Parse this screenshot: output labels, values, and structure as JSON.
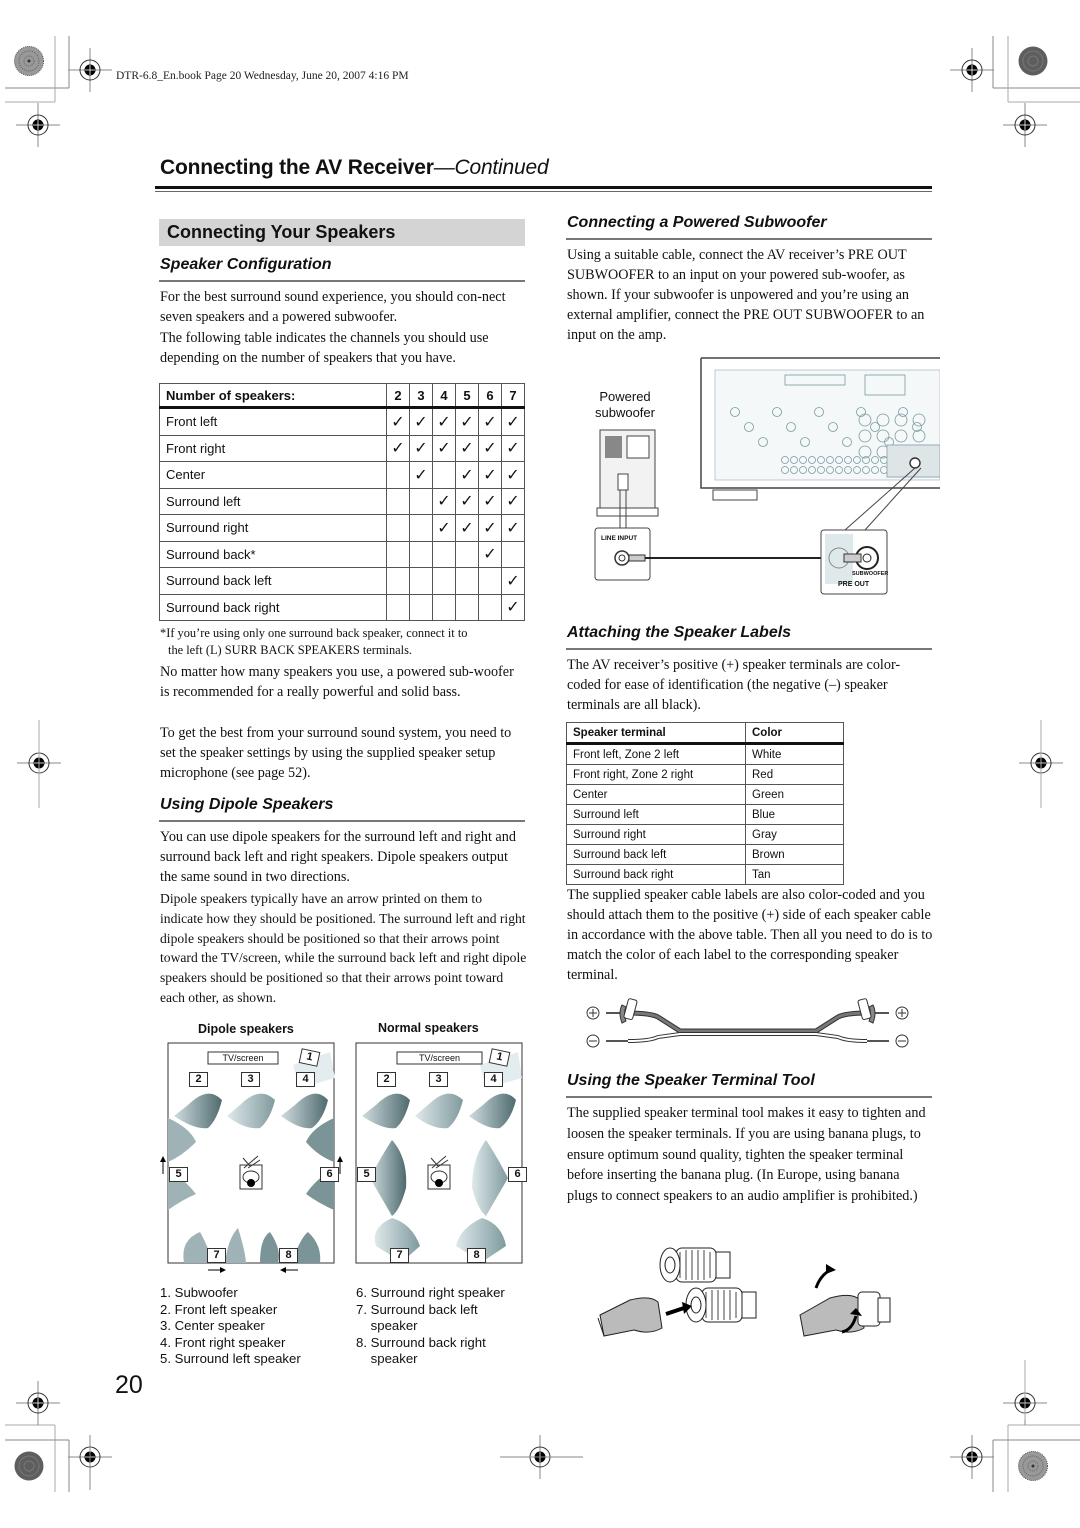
{
  "slug": "DTR-6.8_En.book  Page 20  Wednesday, June 20, 2007  4:16 PM",
  "header": {
    "title": "Connecting the AV Receiver",
    "continued": "—Continued"
  },
  "left": {
    "section_title": "Connecting Your Speakers",
    "speaker_config": {
      "heading": "Speaker Configuration",
      "paragraphs": [
        "For the best surround sound experience, you should con-nect seven speakers and a powered subwoofer.",
        "The following table indicates the channels you should use depending on the number of speakers that you have."
      ],
      "table": {
        "header_label": "Number of speakers:",
        "counts": [
          "2",
          "3",
          "4",
          "5",
          "6",
          "7"
        ],
        "check_glyph": "✓",
        "rows": [
          {
            "label": "Front left",
            "checks": [
              true,
              true,
              true,
              true,
              true,
              true
            ]
          },
          {
            "label": "Front right",
            "checks": [
              true,
              true,
              true,
              true,
              true,
              true
            ]
          },
          {
            "label": "Center",
            "checks": [
              false,
              true,
              false,
              true,
              true,
              true
            ]
          },
          {
            "label": "Surround left",
            "checks": [
              false,
              false,
              true,
              true,
              true,
              true
            ]
          },
          {
            "label": "Surround right",
            "checks": [
              false,
              false,
              true,
              true,
              true,
              true
            ]
          },
          {
            "label": "Surround back*",
            "checks": [
              false,
              false,
              false,
              false,
              true,
              false
            ]
          },
          {
            "label": "Surround back left",
            "checks": [
              false,
              false,
              false,
              false,
              false,
              true
            ]
          },
          {
            "label": "Surround back right",
            "checks": [
              false,
              false,
              false,
              false,
              false,
              true
            ]
          }
        ]
      },
      "footnote_1": "*If you’re using only one surround back speaker, connect it to",
      "footnote_2": "the left (L) SURR BACK SPEAKERS terminals.",
      "para_sub": "No matter how many speakers you use, a powered sub-woofer is recommended for a really powerful and solid bass.",
      "para_setup": "To get the best from your surround sound system, you need to set the speaker settings by using the supplied speaker setup microphone (see page 52)."
    },
    "dipole": {
      "heading": "Using Dipole Speakers",
      "para1": "You can use dipole speakers for the surround left and right and surround back left and right speakers. Dipole speakers output the same sound in two directions.",
      "para2": "Dipole speakers typically have an arrow printed on them to indicate how they should be positioned. The surround left and right dipole speakers should be positioned so that their arrows point toward the TV/screen, while the surround back left and right dipole speakers should be positioned so that their arrows point toward each other, as shown.",
      "diagram_left_title": "Dipole speakers",
      "diagram_right_title": "Normal speakers",
      "tv_label": "TV/screen",
      "box_numbers": [
        "1",
        "2",
        "3",
        "4",
        "5",
        "6",
        "7",
        "8"
      ],
      "legend_left": [
        "1. Subwoofer",
        "2. Front left speaker",
        "3. Center speaker",
        "4. Front right speaker",
        "5. Surround left speaker"
      ],
      "legend_right": [
        "6. Surround right speaker",
        "7. Surround back left",
        "    speaker",
        "8. Surround back right",
        "    speaker"
      ]
    }
  },
  "right": {
    "subwoofer": {
      "heading": "Connecting a Powered Subwoofer",
      "para": "Using a suitable cable, connect the AV receiver’s PRE OUT SUBWOOFER to an input on your powered sub-woofer, as shown. If your subwoofer is unpowered and you’re using an external amplifier, connect the PRE OUT SUBWOOFER to an input on the amp.",
      "label_powered_1": "Powered",
      "label_powered_2": "subwoofer",
      "label_line_input": "LINE INPUT",
      "label_subwoofer": "SUBWOOFER",
      "label_pre_out": "PRE OUT"
    },
    "labels": {
      "heading": "Attaching the Speaker Labels",
      "para": "The AV receiver’s positive (+) speaker terminals are color-coded for ease of identification (the negative (–) speaker terminals are all black).",
      "table_headers": [
        "Speaker terminal",
        "Color"
      ],
      "table_rows": [
        [
          "Front left, Zone 2 left",
          "White"
        ],
        [
          "Front right, Zone 2 right",
          "Red"
        ],
        [
          "Center",
          "Green"
        ],
        [
          "Surround left",
          "Blue"
        ],
        [
          "Surround right",
          "Gray"
        ],
        [
          "Surround back left",
          "Brown"
        ],
        [
          "Surround back right",
          "Tan"
        ]
      ],
      "para2": "The supplied speaker cable labels are also color-coded and you should attach them to the positive (+) side of each speaker cable in accordance with the above table. Then all you need to do is to match the color of each label to the corresponding speaker terminal."
    },
    "tool": {
      "heading": "Using the Speaker Terminal Tool",
      "para": "The supplied speaker terminal tool makes it easy to tighten and loosen the speaker terminals. If you are using banana plugs, to ensure optimum sound quality, tighten the speaker terminal before inserting the banana plug. (In Europe, using banana plugs to connect speakers to an audio amplifier is prohibited.)"
    }
  },
  "page_number": "20"
}
